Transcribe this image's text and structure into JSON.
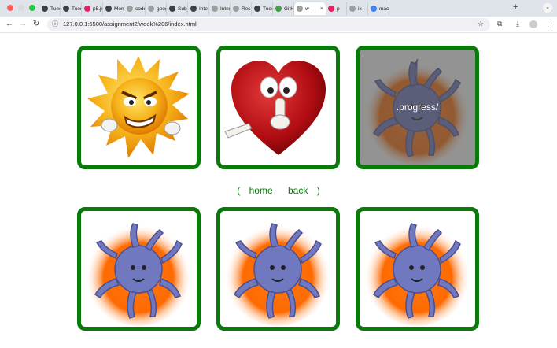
{
  "browser": {
    "tabs": [
      {
        "label": "Tuesd",
        "color": "#3c4043"
      },
      {
        "label": "Tuesd",
        "color": "#3c4043"
      },
      {
        "label": "p5.js",
        "color": "#e91e63"
      },
      {
        "label": "Mon",
        "color": "#3c4043"
      },
      {
        "label": "code",
        "color": "#9e9e9e"
      },
      {
        "label": "googl",
        "color": "#9e9e9e"
      },
      {
        "label": "Subje",
        "color": "#3c4043"
      },
      {
        "label": "Intera",
        "color": "#3c4043"
      },
      {
        "label": "Intera",
        "color": "#9e9e9e"
      },
      {
        "label": "Resea",
        "color": "#9e9e9e"
      },
      {
        "label": "Tuesd",
        "color": "#3c4043"
      },
      {
        "label": "GitH",
        "color": "#43a047"
      }
    ],
    "active_tab": {
      "label": "w",
      "close": "×"
    },
    "extra_tabs": [
      {
        "label": "p",
        "color": "#e91e63"
      },
      {
        "label": "ix",
        "color": "#9e9e9e"
      },
      {
        "label": "mac",
        "color": "#4285f4"
      }
    ],
    "new_tab": "+",
    "url": "127.0.0.1:5500/assignment2/week%206/index.html"
  },
  "overlay": {
    "label": ".progress/"
  },
  "nav": {
    "open": "(",
    "home": "home",
    "back": "back",
    "close": ")"
  },
  "colors": {
    "border": "#0a7a0a",
    "link": "#0a7a0a"
  }
}
